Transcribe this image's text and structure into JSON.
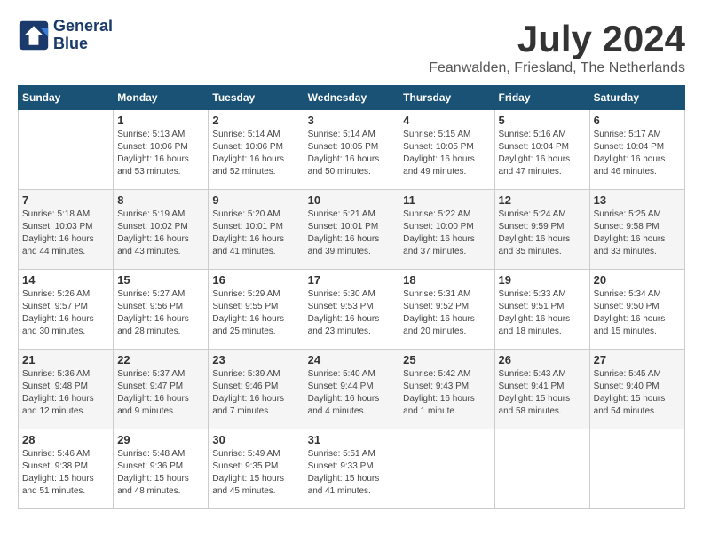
{
  "header": {
    "logo_line1": "General",
    "logo_line2": "Blue",
    "month_title": "July 2024",
    "location": "Feanwalden, Friesland, The Netherlands"
  },
  "days_of_week": [
    "Sunday",
    "Monday",
    "Tuesday",
    "Wednesday",
    "Thursday",
    "Friday",
    "Saturday"
  ],
  "weeks": [
    [
      {
        "day": "",
        "detail": ""
      },
      {
        "day": "1",
        "detail": "Sunrise: 5:13 AM\nSunset: 10:06 PM\nDaylight: 16 hours\nand 53 minutes."
      },
      {
        "day": "2",
        "detail": "Sunrise: 5:14 AM\nSunset: 10:06 PM\nDaylight: 16 hours\nand 52 minutes."
      },
      {
        "day": "3",
        "detail": "Sunrise: 5:14 AM\nSunset: 10:05 PM\nDaylight: 16 hours\nand 50 minutes."
      },
      {
        "day": "4",
        "detail": "Sunrise: 5:15 AM\nSunset: 10:05 PM\nDaylight: 16 hours\nand 49 minutes."
      },
      {
        "day": "5",
        "detail": "Sunrise: 5:16 AM\nSunset: 10:04 PM\nDaylight: 16 hours\nand 47 minutes."
      },
      {
        "day": "6",
        "detail": "Sunrise: 5:17 AM\nSunset: 10:04 PM\nDaylight: 16 hours\nand 46 minutes."
      }
    ],
    [
      {
        "day": "7",
        "detail": "Sunrise: 5:18 AM\nSunset: 10:03 PM\nDaylight: 16 hours\nand 44 minutes."
      },
      {
        "day": "8",
        "detail": "Sunrise: 5:19 AM\nSunset: 10:02 PM\nDaylight: 16 hours\nand 43 minutes."
      },
      {
        "day": "9",
        "detail": "Sunrise: 5:20 AM\nSunset: 10:01 PM\nDaylight: 16 hours\nand 41 minutes."
      },
      {
        "day": "10",
        "detail": "Sunrise: 5:21 AM\nSunset: 10:01 PM\nDaylight: 16 hours\nand 39 minutes."
      },
      {
        "day": "11",
        "detail": "Sunrise: 5:22 AM\nSunset: 10:00 PM\nDaylight: 16 hours\nand 37 minutes."
      },
      {
        "day": "12",
        "detail": "Sunrise: 5:24 AM\nSunset: 9:59 PM\nDaylight: 16 hours\nand 35 minutes."
      },
      {
        "day": "13",
        "detail": "Sunrise: 5:25 AM\nSunset: 9:58 PM\nDaylight: 16 hours\nand 33 minutes."
      }
    ],
    [
      {
        "day": "14",
        "detail": "Sunrise: 5:26 AM\nSunset: 9:57 PM\nDaylight: 16 hours\nand 30 minutes."
      },
      {
        "day": "15",
        "detail": "Sunrise: 5:27 AM\nSunset: 9:56 PM\nDaylight: 16 hours\nand 28 minutes."
      },
      {
        "day": "16",
        "detail": "Sunrise: 5:29 AM\nSunset: 9:55 PM\nDaylight: 16 hours\nand 25 minutes."
      },
      {
        "day": "17",
        "detail": "Sunrise: 5:30 AM\nSunset: 9:53 PM\nDaylight: 16 hours\nand 23 minutes."
      },
      {
        "day": "18",
        "detail": "Sunrise: 5:31 AM\nSunset: 9:52 PM\nDaylight: 16 hours\nand 20 minutes."
      },
      {
        "day": "19",
        "detail": "Sunrise: 5:33 AM\nSunset: 9:51 PM\nDaylight: 16 hours\nand 18 minutes."
      },
      {
        "day": "20",
        "detail": "Sunrise: 5:34 AM\nSunset: 9:50 PM\nDaylight: 16 hours\nand 15 minutes."
      }
    ],
    [
      {
        "day": "21",
        "detail": "Sunrise: 5:36 AM\nSunset: 9:48 PM\nDaylight: 16 hours\nand 12 minutes."
      },
      {
        "day": "22",
        "detail": "Sunrise: 5:37 AM\nSunset: 9:47 PM\nDaylight: 16 hours\nand 9 minutes."
      },
      {
        "day": "23",
        "detail": "Sunrise: 5:39 AM\nSunset: 9:46 PM\nDaylight: 16 hours\nand 7 minutes."
      },
      {
        "day": "24",
        "detail": "Sunrise: 5:40 AM\nSunset: 9:44 PM\nDaylight: 16 hours\nand 4 minutes."
      },
      {
        "day": "25",
        "detail": "Sunrise: 5:42 AM\nSunset: 9:43 PM\nDaylight: 16 hours\nand 1 minute."
      },
      {
        "day": "26",
        "detail": "Sunrise: 5:43 AM\nSunset: 9:41 PM\nDaylight: 15 hours\nand 58 minutes."
      },
      {
        "day": "27",
        "detail": "Sunrise: 5:45 AM\nSunset: 9:40 PM\nDaylight: 15 hours\nand 54 minutes."
      }
    ],
    [
      {
        "day": "28",
        "detail": "Sunrise: 5:46 AM\nSunset: 9:38 PM\nDaylight: 15 hours\nand 51 minutes."
      },
      {
        "day": "29",
        "detail": "Sunrise: 5:48 AM\nSunset: 9:36 PM\nDaylight: 15 hours\nand 48 minutes."
      },
      {
        "day": "30",
        "detail": "Sunrise: 5:49 AM\nSunset: 9:35 PM\nDaylight: 15 hours\nand 45 minutes."
      },
      {
        "day": "31",
        "detail": "Sunrise: 5:51 AM\nSunset: 9:33 PM\nDaylight: 15 hours\nand 41 minutes."
      },
      {
        "day": "",
        "detail": ""
      },
      {
        "day": "",
        "detail": ""
      },
      {
        "day": "",
        "detail": ""
      }
    ]
  ]
}
